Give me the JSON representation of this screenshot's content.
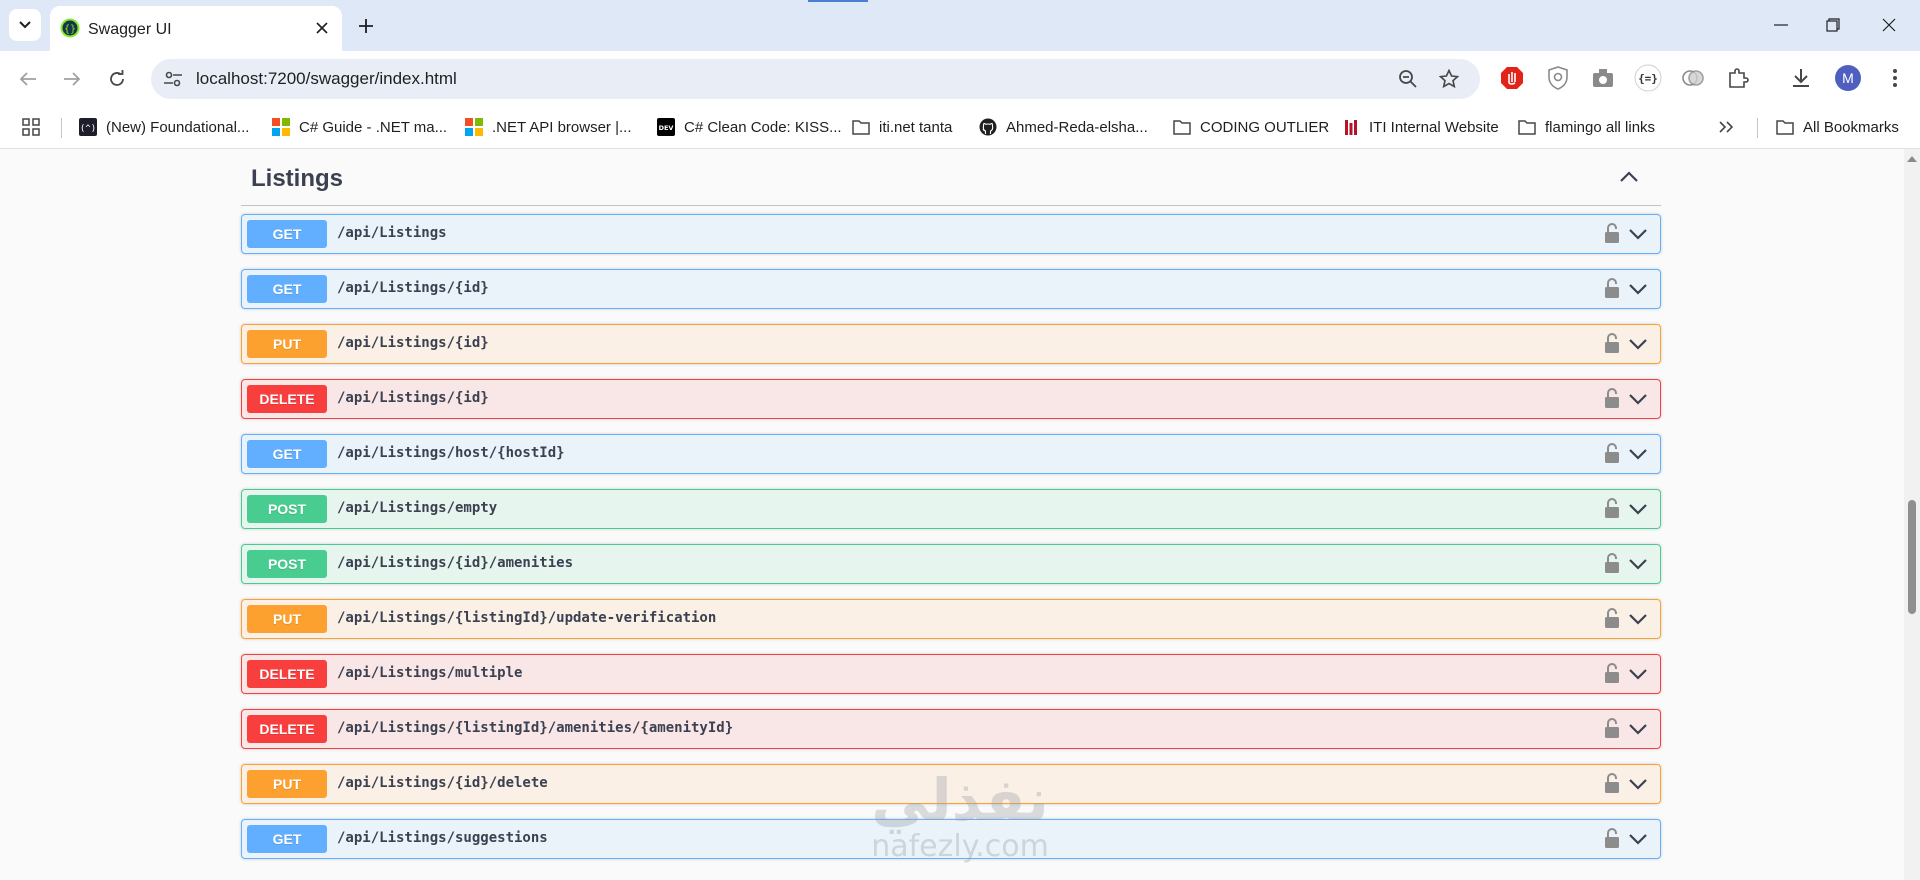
{
  "browser": {
    "tab_title": "Swagger UI",
    "url": "localhost:7200/swagger/index.html",
    "avatar_initial": "M",
    "bookmarks": [
      {
        "label": "(New) Foundational...",
        "icon": "dev-icon"
      },
      {
        "label": "C# Guide - .NET ma...",
        "icon": "microsoft-icon"
      },
      {
        "label": ".NET API browser |...",
        "icon": "microsoft-icon"
      },
      {
        "label": "C# Clean Code: KISS...",
        "icon": "dev-to-icon"
      },
      {
        "label": "iti.net tanta",
        "icon": "folder-icon"
      },
      {
        "label": "Ahmed-Reda-elsha...",
        "icon": "github-icon"
      },
      {
        "label": "CODING OUTLIER",
        "icon": "folder-icon"
      },
      {
        "label": "ITI Internal Website",
        "icon": "iti-icon"
      },
      {
        "label": "flamingo all links",
        "icon": "folder-icon"
      }
    ],
    "all_bookmarks_label": "All Bookmarks",
    "dev_badge": "DEV"
  },
  "swagger": {
    "section_title": "Listings",
    "operations": [
      {
        "method": "GET",
        "path": "/api/Listings"
      },
      {
        "method": "GET",
        "path": "/api/Listings/{id}"
      },
      {
        "method": "PUT",
        "path": "/api/Listings/{id}"
      },
      {
        "method": "DELETE",
        "path": "/api/Listings/{id}"
      },
      {
        "method": "GET",
        "path": "/api/Listings/host/{hostId}"
      },
      {
        "method": "POST",
        "path": "/api/Listings/empty"
      },
      {
        "method": "POST",
        "path": "/api/Listings/{id}/amenities"
      },
      {
        "method": "PUT",
        "path": "/api/Listings/{listingId}/update-verification"
      },
      {
        "method": "DELETE",
        "path": "/api/Listings/multiple"
      },
      {
        "method": "DELETE",
        "path": "/api/Listings/{listingId}/amenities/{amenityId}"
      },
      {
        "method": "PUT",
        "path": "/api/Listings/{id}/delete"
      },
      {
        "method": "GET",
        "path": "/api/Listings/suggestions"
      }
    ]
  },
  "watermark": {
    "arabic": "نفذلي",
    "latin": "nafezly.com"
  },
  "colors": {
    "get": "#61affe",
    "put": "#fca130",
    "post": "#49cc90",
    "delete": "#f93e3e",
    "text": "#3b4151"
  }
}
